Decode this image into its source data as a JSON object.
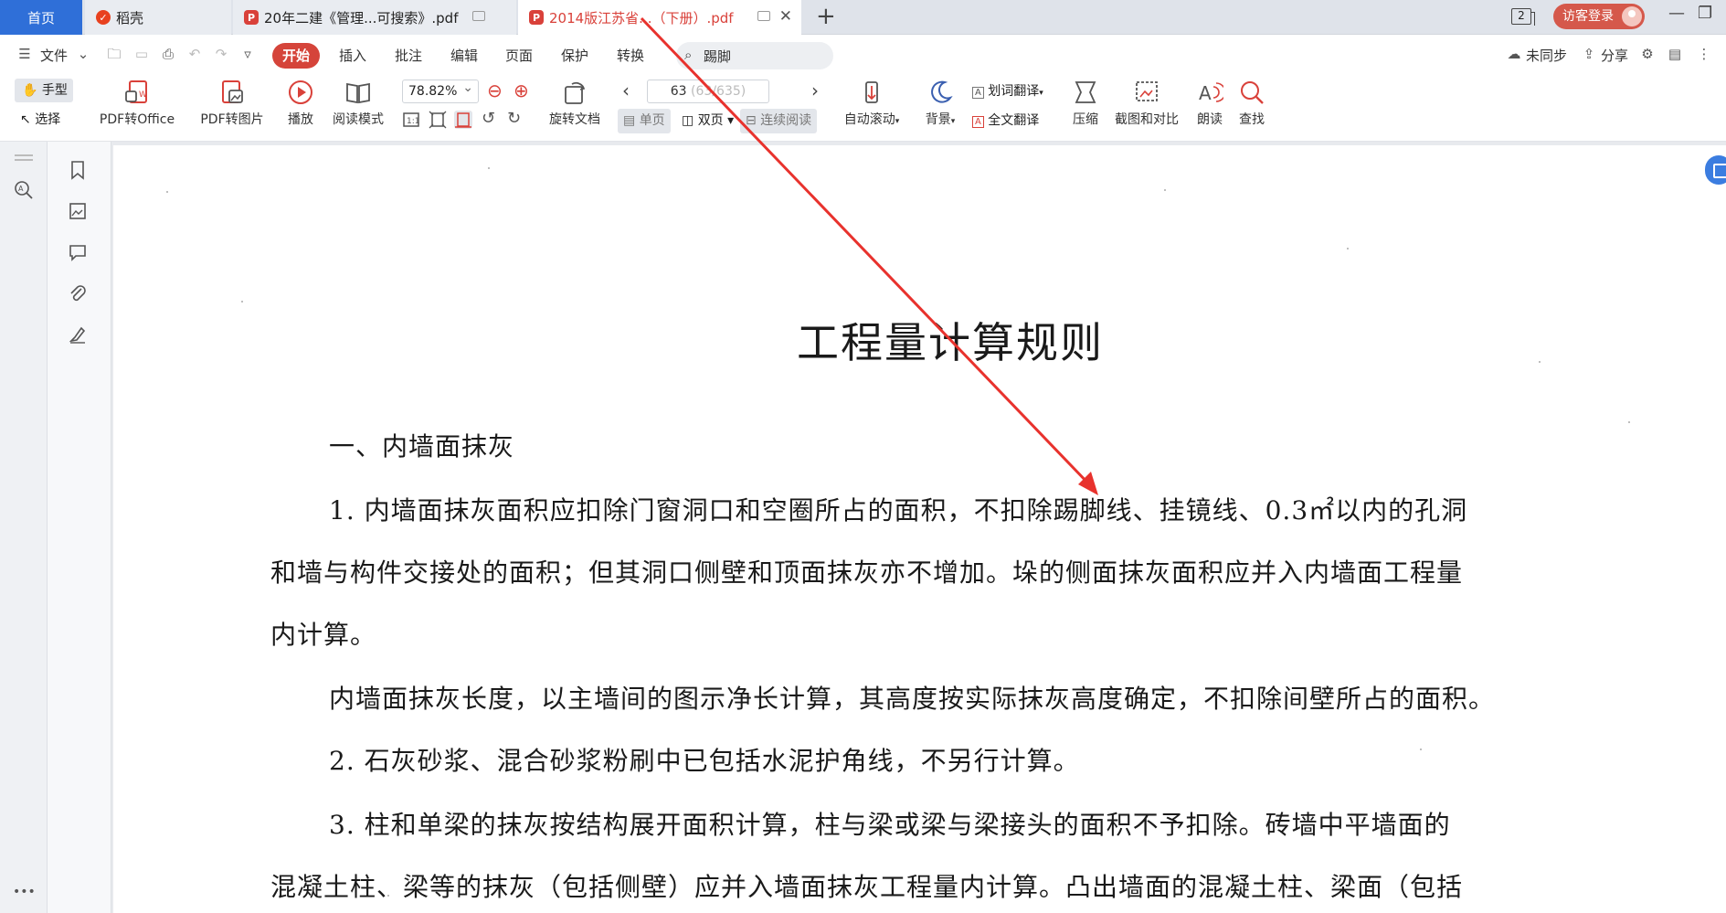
{
  "tabs": {
    "home": "首页",
    "docer": "稻壳",
    "pdf1": "20年二建《管理...可搜索》.pdf",
    "pdf2": "2014版江苏省...（下册）.pdf",
    "window_count": "2",
    "login": "访客登录"
  },
  "menu": {
    "file": "文件",
    "start": "开始",
    "insert": "插入",
    "annotate": "批注",
    "edit": "编辑",
    "page": "页面",
    "protect": "保护",
    "convert": "转换",
    "search_value": "踢脚",
    "sync": "未同步",
    "share": "分享"
  },
  "toolbar": {
    "hand": "手型",
    "select": "选择",
    "pdf_to_office": "PDF转Office",
    "pdf_to_image": "PDF转图片",
    "play": "播放",
    "read_mode": "阅读模式",
    "zoom": "78.82%",
    "rotate_doc": "旋转文档",
    "page_current": "63",
    "page_total": "(63/635)",
    "single_page": "单页",
    "double_page": "双页",
    "continuous": "连续阅读",
    "auto_scroll": "自动滚动",
    "background": "背景",
    "word_translate": "划词翻译",
    "full_translate": "全文翻译",
    "compress": "压缩",
    "screenshot_compare": "截图和对比",
    "read_aloud": "朗读",
    "find": "查找"
  },
  "sidebar": {
    "more": "•••"
  },
  "document": {
    "title": "工程量计算规则",
    "lines": [
      "一、内墙面抹灰",
      "1. 内墙面抹灰面积应扣除门窗洞口和空圈所占的面积，不扣除踢脚线、挂镜线、0.3㎡以内的孔洞",
      "和墙与构件交接处的面积；但其洞口侧壁和顶面抹灰亦不增加。垛的侧面抹灰面积应并入内墙面工程量",
      "内计算。",
      "内墙面抹灰长度，以主墙间的图示净长计算，其高度按实际抹灰高度确定，不扣除间壁所占的面积。",
      "2. 石灰砂浆、混合砂浆粉刷中已包括水泥护角线，不另行计算。",
      "3. 柱和单梁的抹灰按结构展开面积计算，柱与梁或梁与梁接头的面积不予扣除。砖墙中平墙面的",
      "混凝土柱、梁等的抹灰（包括侧壁）应并入墙面抹灰工程量内计算。凸出墙面的混凝土柱、梁面（包括"
    ]
  },
  "colors": {
    "accent": "#d5443a",
    "home_tab": "#2f6fd8",
    "annotation_arrow": "#e8322d"
  }
}
